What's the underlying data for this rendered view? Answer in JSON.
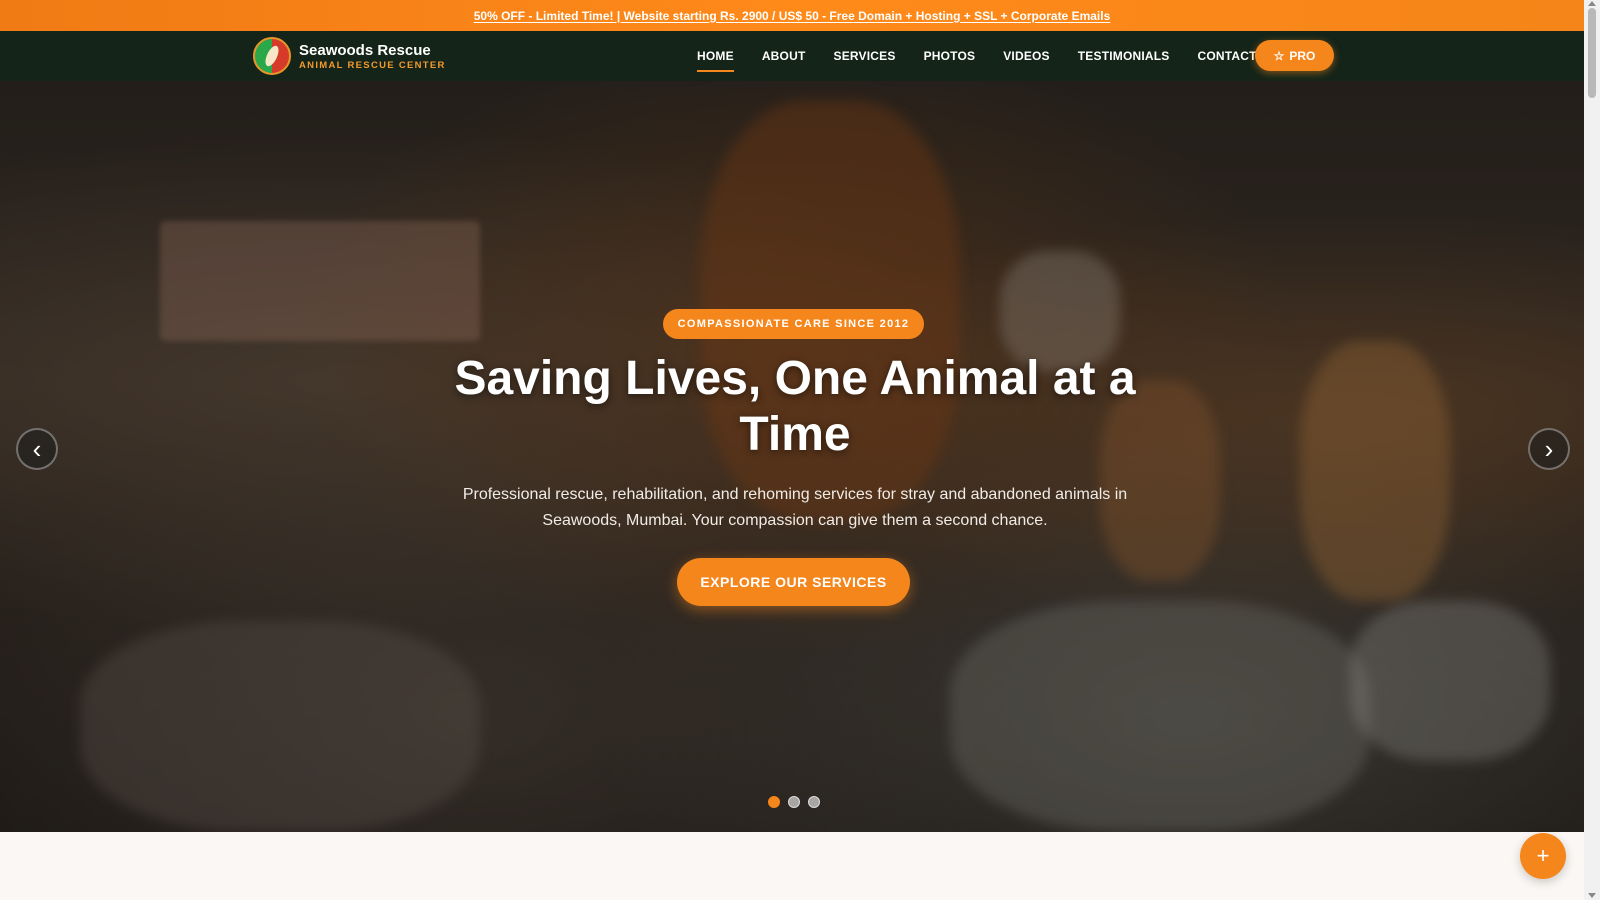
{
  "promo": {
    "text": "50% OFF - Limited Time! | Website starting Rs. 2900 / US$ 50 - Free Domain + Hosting + SSL + Corporate Emails"
  },
  "brand": {
    "name": "Seawoods Rescue",
    "tagline": "ANIMAL RESCUE CENTER"
  },
  "nav": {
    "items": [
      {
        "label": "HOME"
      },
      {
        "label": "ABOUT"
      },
      {
        "label": "SERVICES"
      },
      {
        "label": "PHOTOS"
      },
      {
        "label": "VIDEOS"
      },
      {
        "label": "TESTIMONIALS"
      },
      {
        "label": "CONTACT"
      }
    ],
    "active_index": 0,
    "pro_label": "PRO"
  },
  "hero": {
    "badge": "COMPASSIONATE CARE SINCE 2012",
    "title": "Saving Lives, One Animal at a Time",
    "description": "Professional rescue, rehabilitation, and rehoming services for stray and abandoned animals in Seawoods, Mumbai. Your compassion can give them a second chance.",
    "cta_label": "EXPLORE OUR SERVICES",
    "prev_arrow": "‹",
    "next_arrow": "›",
    "slide_count": 3,
    "active_slide": 1
  },
  "fab": {
    "symbol": "+"
  },
  "colors": {
    "accent": "#f5861c",
    "nav_bg": "#142419",
    "promo_bg": "#ff8a1a"
  }
}
